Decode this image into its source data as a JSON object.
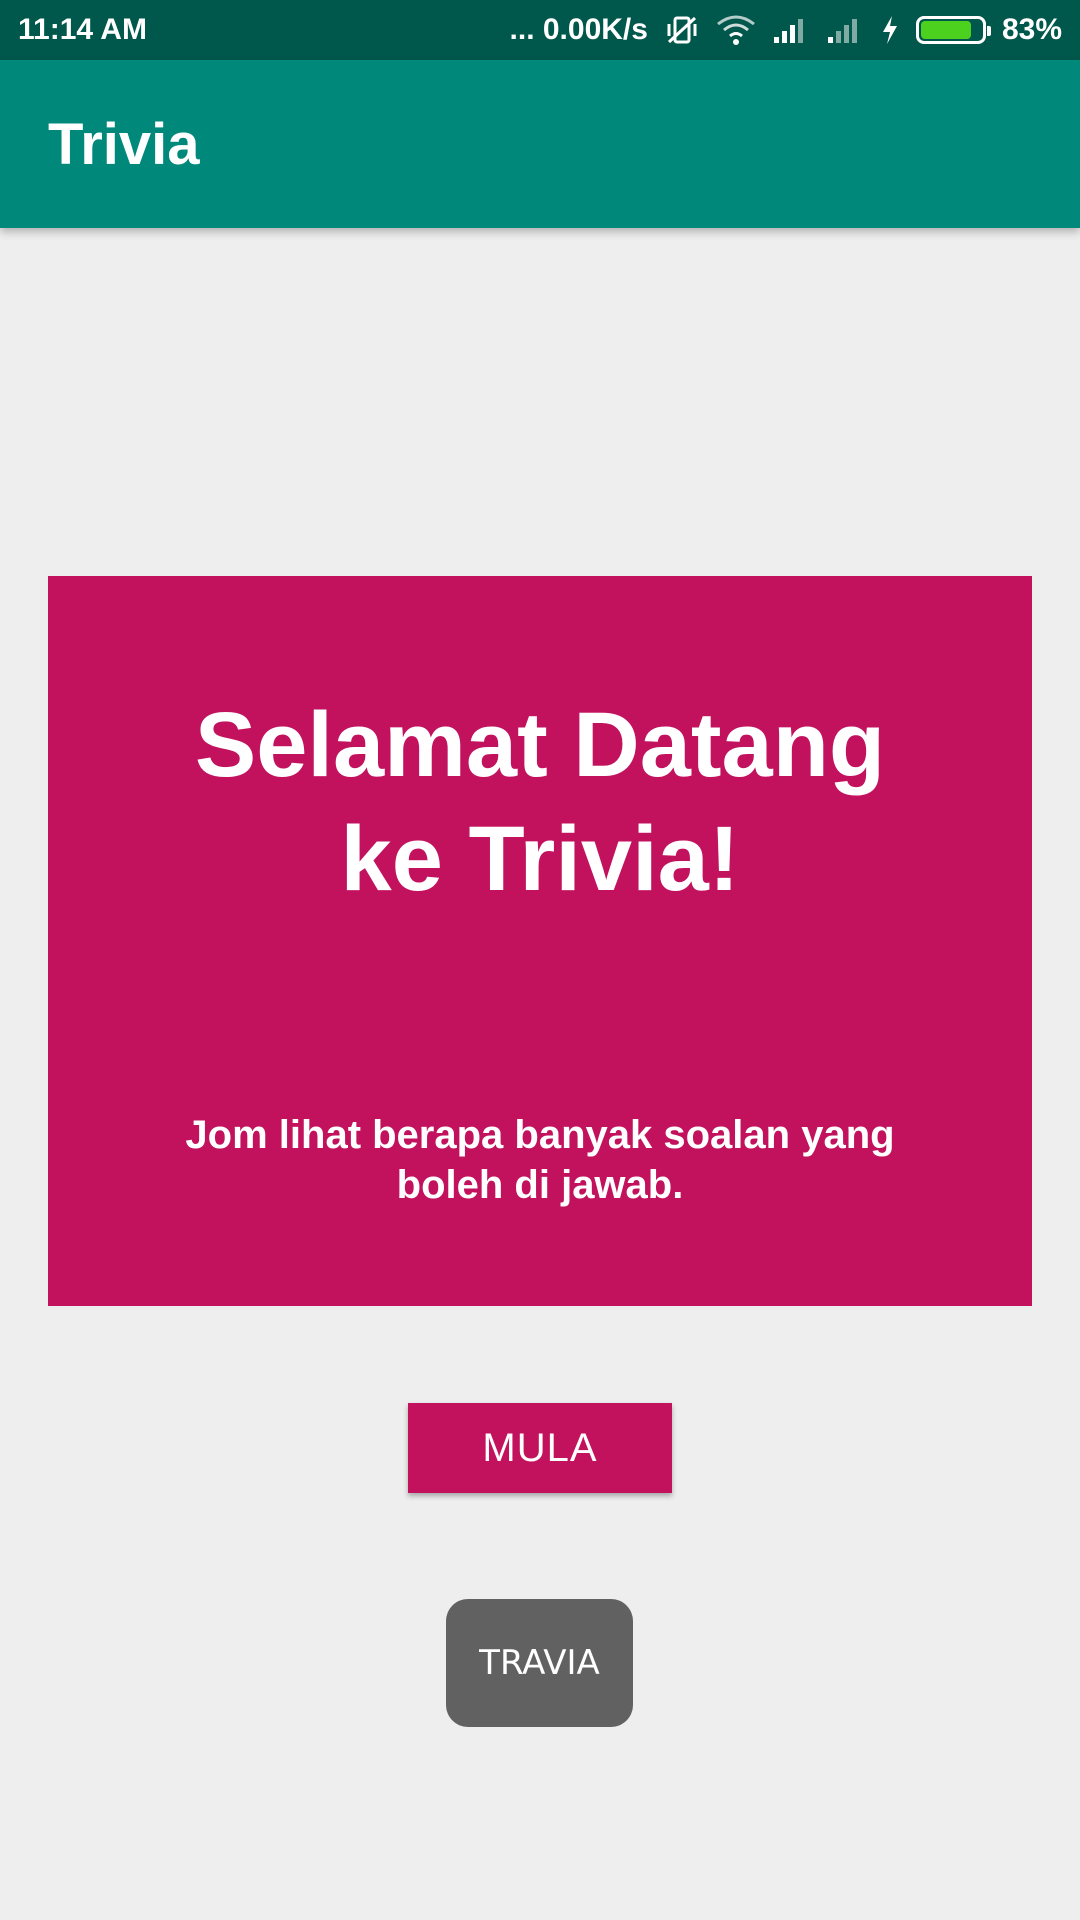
{
  "status_bar": {
    "time": "11:14 AM",
    "network_speed": "... 0.00K/s",
    "battery_percent": "83%",
    "battery_level": 0.83,
    "icons": [
      "vibrate-off-icon",
      "wifi-icon",
      "signal-icon",
      "signal-icon-2",
      "charging-icon",
      "battery-icon"
    ]
  },
  "app_bar": {
    "title": "Trivia"
  },
  "welcome_card": {
    "headline": "Selamat Datang ke Trivia!",
    "subtext": "Jom lihat berapa banyak soalan yang boleh di jawab."
  },
  "start_button": {
    "label": "MULA"
  },
  "toast": {
    "text": "TRAVIA"
  },
  "colors": {
    "status_bar": "#00574b",
    "app_bar": "#00897b",
    "accent": "#c2125e",
    "background": "#eeeeee",
    "toast": "#616161"
  }
}
